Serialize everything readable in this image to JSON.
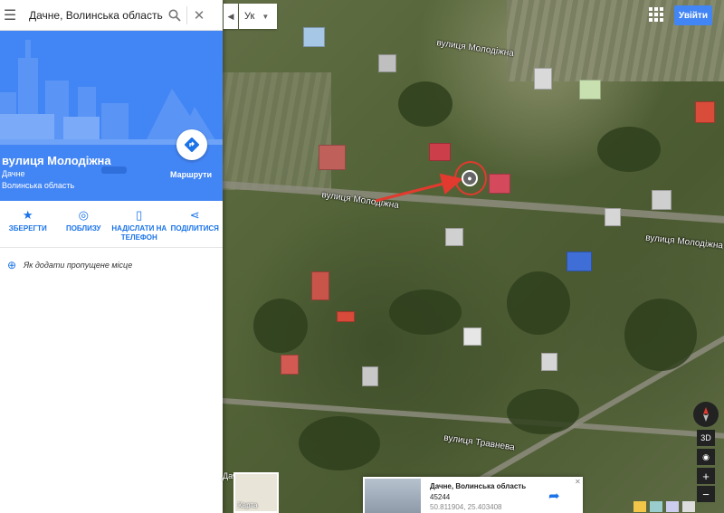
{
  "search": {
    "value": "Дачне, Волинська область, Укр"
  },
  "place": {
    "title": "вулиця Молодіжна",
    "subtitle_1": "Дачне",
    "subtitle_2": "Волинська область",
    "directions_label": "Маршрути"
  },
  "actions": [
    {
      "icon": "bookmark-icon",
      "label": "ЗБЕРЕГТИ"
    },
    {
      "icon": "nearby-icon",
      "label": "ПОБЛИЗУ"
    },
    {
      "icon": "send-to-phone-icon",
      "label": "НАДІСЛАТИ НА ТЕЛЕФОН"
    },
    {
      "icon": "share-icon",
      "label": "ПОДІЛИТИСЯ"
    }
  ],
  "missing_place": {
    "label": "Як додати пропущене місце"
  },
  "topbar": {
    "lang_tab": "◀",
    "lang_value": "Ук",
    "signin_label": "Увійти"
  },
  "map": {
    "street_labels": [
      "вулиця Молодіжна",
      "вулиця Молодіжна",
      "вулиця Молодіжна",
      "вулиця Травнева"
    ],
    "partial_label": "Дач"
  },
  "minimap": {
    "label": "Карта"
  },
  "info_card": {
    "title": "Дачне, Волинська область",
    "code": "45244",
    "coords": "50.811904, 25.403408",
    "close": "✕"
  },
  "controls": {
    "view_3d": "3D"
  },
  "colors": {
    "accent": "#4285f4",
    "pin_circle": "#e23a2e",
    "arrow": "#e23a2e"
  }
}
